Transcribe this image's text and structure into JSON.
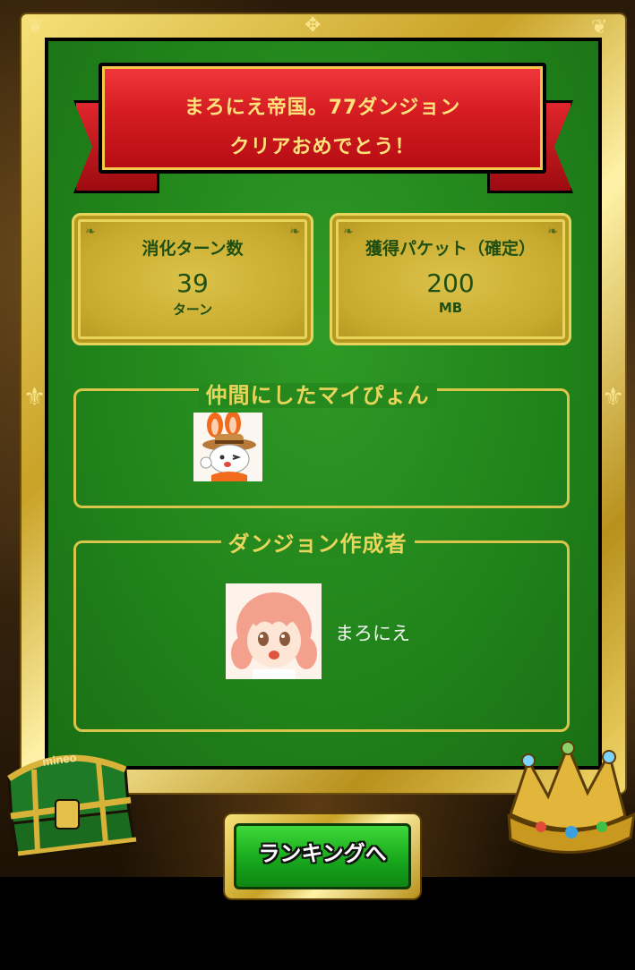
{
  "banner": {
    "line1": "まろにえ帝国。77ダンジョン",
    "line2": "クリアおめでとう！"
  },
  "stats": {
    "turns": {
      "label": "消化ターン数",
      "value": "39",
      "unit": "ターン"
    },
    "packets": {
      "label": "獲得パケット（確定）",
      "value": "200",
      "unit": "MB"
    }
  },
  "sections": {
    "companions": {
      "title": "仲間にしたマイぴょん"
    },
    "creator": {
      "title": "ダンジョン作成者",
      "name": "まろにえ"
    }
  },
  "chest_label": "mineo",
  "button": {
    "label": "ランキングへ"
  },
  "colors": {
    "felt_green": "#21841b",
    "gold": "#d9c54a",
    "ribbon_red": "#d41c22",
    "ribbon_text": "#ffe27a",
    "button_green": "#18a81d"
  }
}
